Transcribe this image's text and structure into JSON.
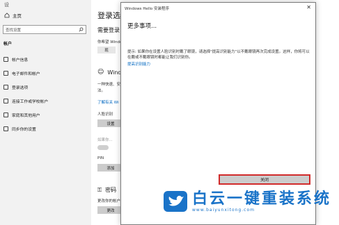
{
  "nav": {
    "top_label": "设",
    "home_label": "主页",
    "search_placeholder": "查找设置",
    "section_label": "帐户",
    "items": [
      {
        "label": "帐户信息",
        "icon": "person-icon"
      },
      {
        "label": "电子邮件和帐户",
        "icon": "mail-icon"
      },
      {
        "label": "登录选项",
        "icon": "key-icon"
      },
      {
        "label": "连接工作或学校帐户",
        "icon": "briefcase-icon"
      },
      {
        "label": "家庭和其他用户",
        "icon": "people-icon"
      },
      {
        "label": "同步你的设置",
        "icon": "sync-icon"
      }
    ]
  },
  "page": {
    "title": "登录选",
    "require_heading": "需要登录",
    "windows_line": "你希望 Windo",
    "select_value": "现",
    "hello_heading": "Wind",
    "hello_desc_1": "一种快速、安",
    "hello_desc_2": "法。",
    "learn_link": "了解有关 Wi",
    "face_label": "人脸识别",
    "setup_button": "设置",
    "toggle_label": "如果你...",
    "pin_label": "PIN",
    "add_button": "添加",
    "password_heading": "密码",
    "password_desc": "更改你的帐户",
    "change_button": "更改"
  },
  "dialog": {
    "title": "Windows Hello 安装程序",
    "close": "✕",
    "heading": "更多事项...",
    "tip": "提示: 如果你在设置人脸识别时戴了眼镜，请选择\"提高识别能力\"以不戴眼镜再次完成设置。这样，你将可以在戴或不戴眼镜时都能让我们识别你。",
    "tip_link": "提高识别能力",
    "close_button": "关闭"
  },
  "watermark": {
    "name": "白云一键重装系统",
    "url": "www.baiyunxitong.com",
    "color": "#1a73c8"
  }
}
